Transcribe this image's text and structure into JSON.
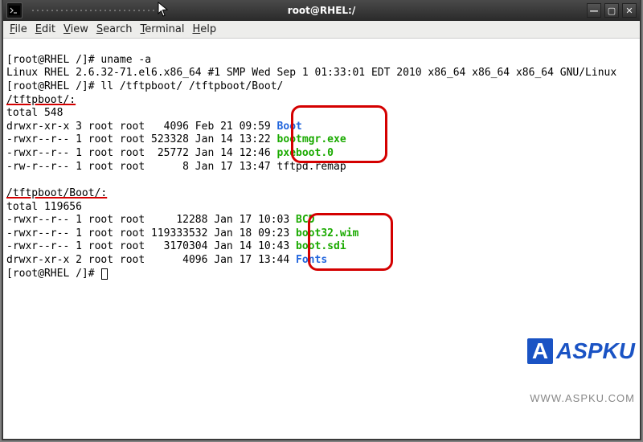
{
  "window": {
    "title": "root@RHEL:/",
    "controls": {
      "minimize": "—",
      "maximize": "▢",
      "close": "✕"
    }
  },
  "menu": {
    "file": "File",
    "edit": "Edit",
    "view": "View",
    "search": "Search",
    "terminal": "Terminal",
    "help": "Help"
  },
  "terminal": {
    "prompt": "[root@RHEL /]# ",
    "cmd1": "uname -a",
    "uname_out": "Linux RHEL 2.6.32-71.el6.x86_64 #1 SMP Wed Sep 1 01:33:01 EDT 2010 x86_64 x86_64 x86_64 GNU/Linux",
    "cmd2": "ll /tftpboot/ /tftpboot/Boot/",
    "hdr1": "/tftpboot/:",
    "total1": "total 548",
    "ls1": [
      {
        "meta": "drwxr-xr-x 3 root root   4096 Feb 21 09:59 ",
        "name": "Boot",
        "color": "blue"
      },
      {
        "meta": "-rwxr--r-- 1 root root 523328 Jan 14 13:22 ",
        "name": "bootmgr.exe",
        "color": "green"
      },
      {
        "meta": "-rwxr--r-- 1 root root  25772 Jan 14 12:46 ",
        "name": "pxeboot.0",
        "color": "green"
      },
      {
        "meta": "-rw-r--r-- 1 root root      8 Jan 17 13:47 ",
        "name": "tftpd.remap",
        "color": "dark"
      }
    ],
    "hdr2": "/tftpboot/Boot/:",
    "total2": "total 119656",
    "ls2": [
      {
        "meta": "-rwxr--r-- 1 root root     12288 Jan 17 10:03 ",
        "name": "BCD",
        "color": "green"
      },
      {
        "meta": "-rwxr--r-- 1 root root 119333532 Jan 18 09:23 ",
        "name": "boot32.wim",
        "color": "green"
      },
      {
        "meta": "-rwxr--r-- 1 root root   3170304 Jan 14 10:43 ",
        "name": "boot.sdi",
        "color": "green"
      },
      {
        "meta": "drwxr-xr-x 2 root root      4096 Jan 17 13:44 ",
        "name": "Fonts",
        "color": "blue"
      }
    ]
  },
  "watermark": {
    "brand": "ASPKU",
    "url": "WWW.ASPKU.COM"
  }
}
